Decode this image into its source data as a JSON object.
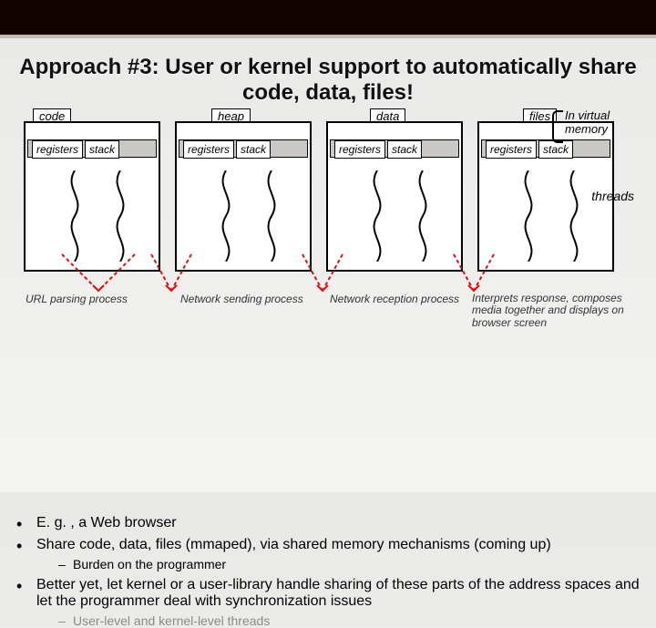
{
  "title": "Approach #3: User or kernel support to automatically share code, data, files!",
  "shared": {
    "code": "code",
    "heap": "heap",
    "data": "data",
    "files": "files"
  },
  "chip": {
    "registers": "registers",
    "stack": "stack"
  },
  "annotations": {
    "vm": "In virtual memory",
    "threads": "threads"
  },
  "proc": {
    "url": "URL parsing process",
    "send": "Network sending process",
    "recv": "Network reception process",
    "interp": "Interprets response, composes media together and displays on browser screen"
  },
  "bullets": {
    "b1": "E. g. , a Web browser",
    "b2": "Share code, data, files (mmaped), via shared memory mechanisms (coming up)",
    "b2s1": "Burden on the programmer",
    "b3": "Better yet, let kernel or a user-library handle sharing of these parts of the address spaces and let the programmer deal with synchronization issues",
    "b3s1": "User-level and kernel-level threads"
  }
}
